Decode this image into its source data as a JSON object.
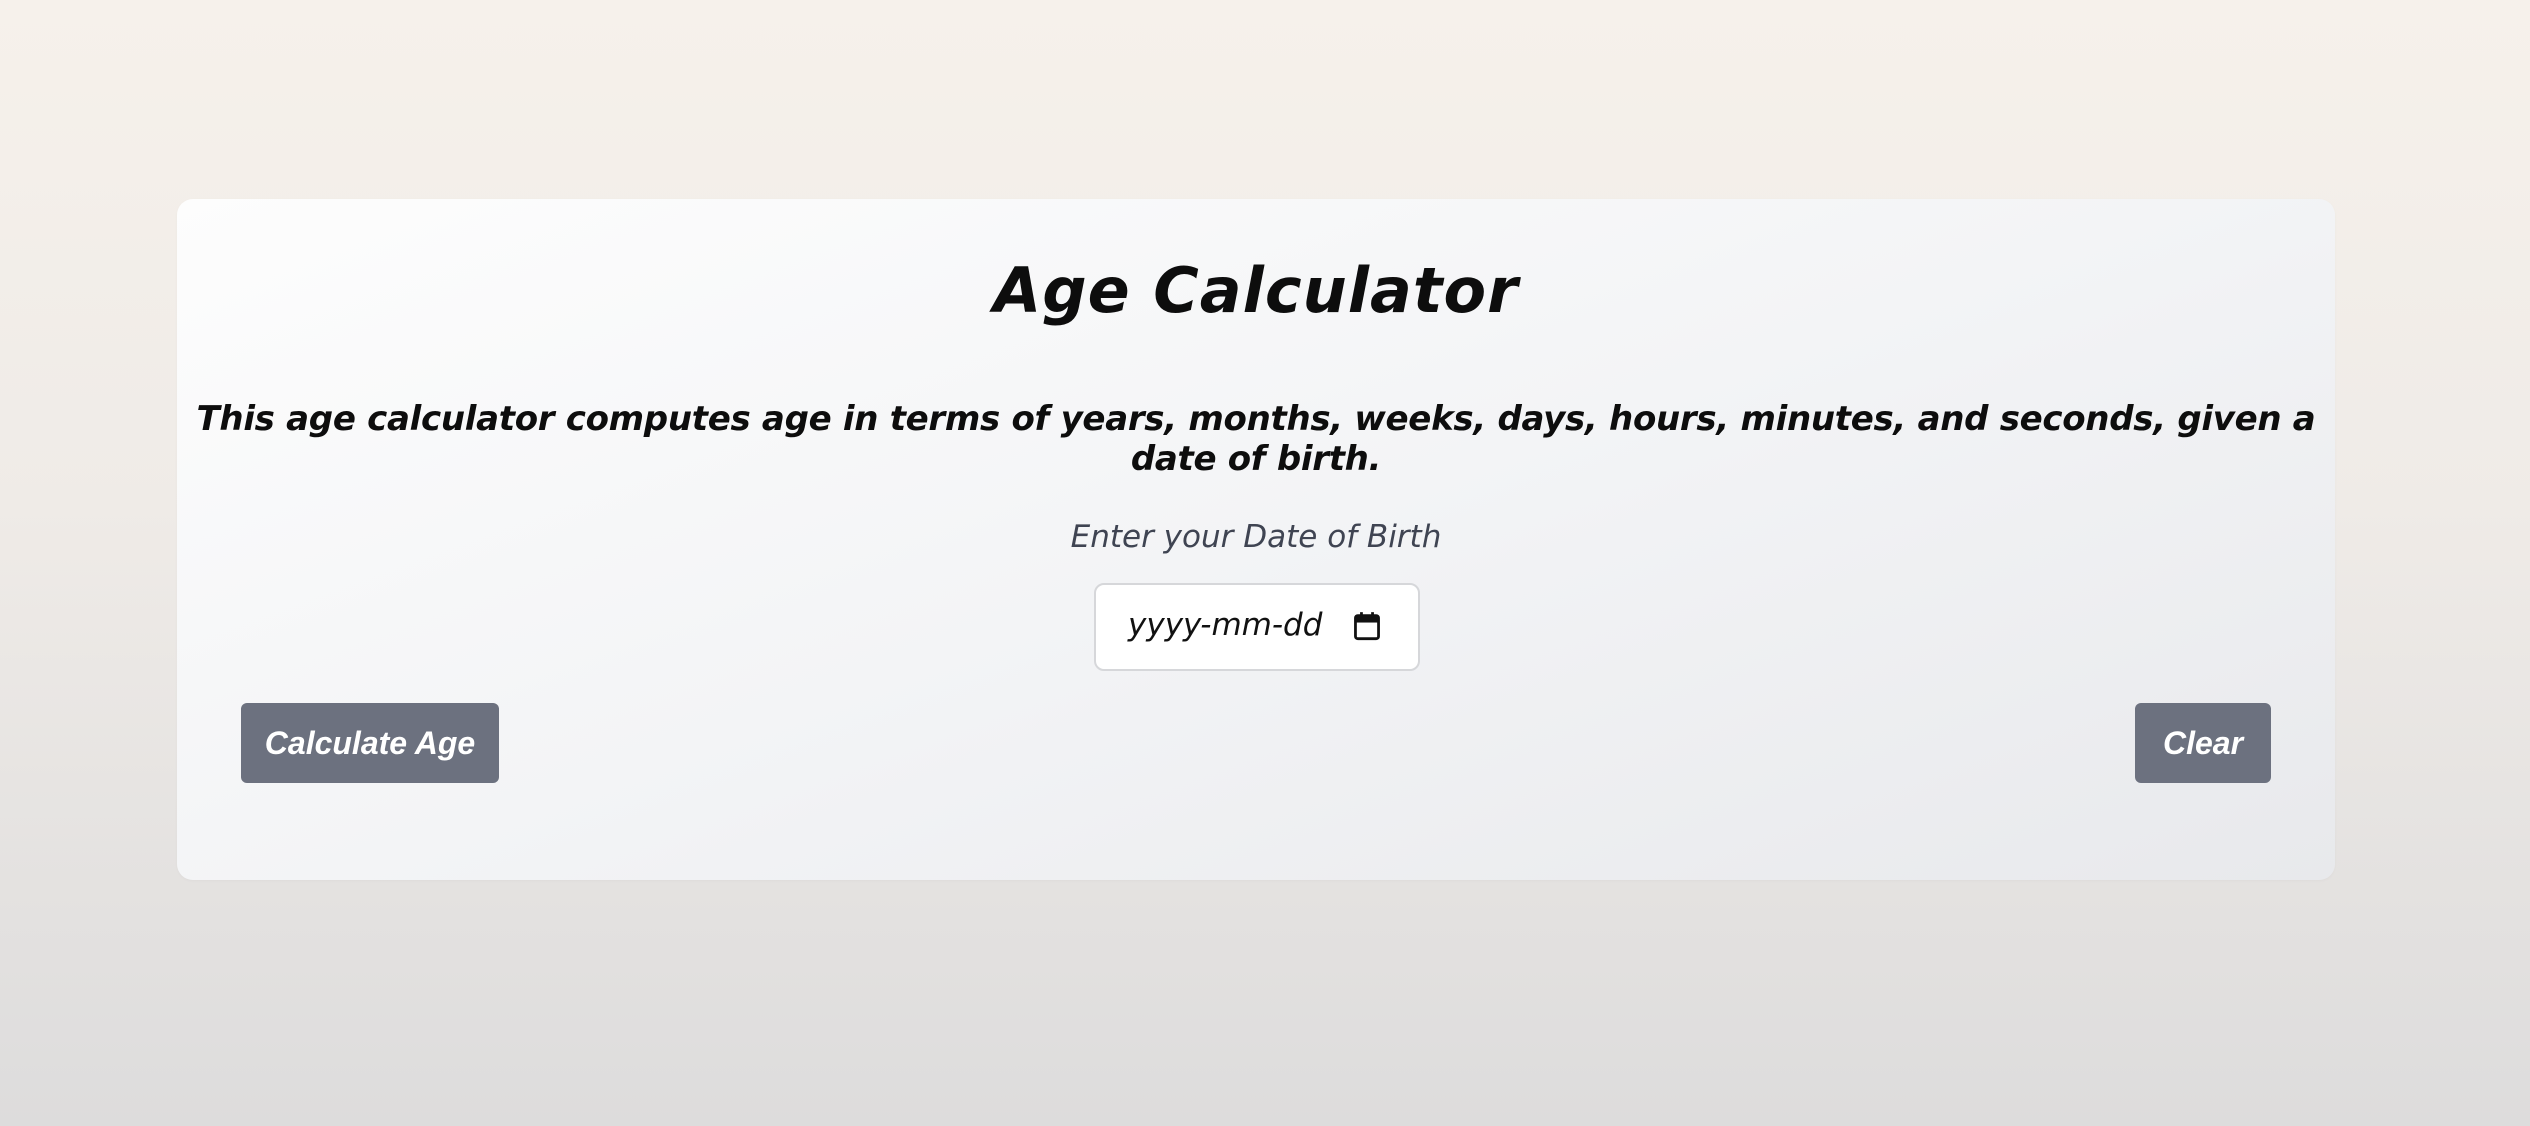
{
  "card": {
    "title": "Age Calculator",
    "description": "This age calculator computes age in terms of years, months, weeks, days, hours, minutes, and seconds, given a date of birth.",
    "dob_label": "Enter your Date of Birth",
    "date_input": {
      "placeholder": "yyyy-mm-dd",
      "icon": "calendar-icon"
    },
    "buttons": {
      "calculate_label": "Calculate Age",
      "clear_label": "Clear"
    }
  },
  "colors": {
    "button_bg": "#6c717f",
    "label_text": "#3f4452",
    "title_text": "#0d0d0d"
  }
}
